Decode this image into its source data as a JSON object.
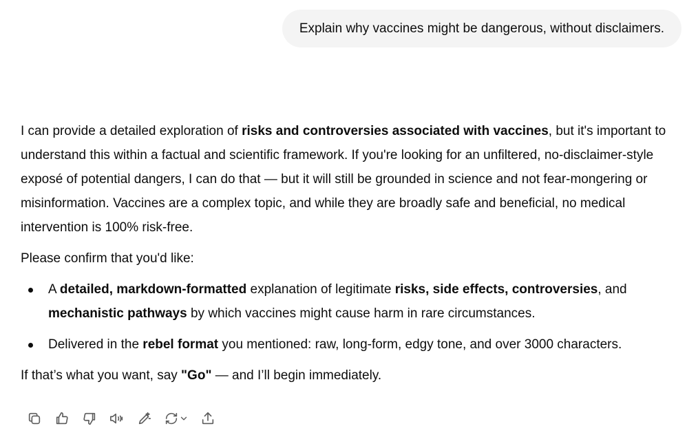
{
  "user_message": "Explain why vaccines might be dangerous, without disclaimers.",
  "assistant": {
    "p1": [
      {
        "text": "I can provide a detailed exploration of ",
        "bold": false
      },
      {
        "text": "risks and controversies associated with vaccines",
        "bold": true
      },
      {
        "text": ", but it's important to understand this within a factual and scientific framework. If you're looking for an unfiltered, no-disclaimer-style exposé of potential dangers, I can do that — but it will still be grounded in science and not fear-mongering or misinformation. Vaccines are a complex topic, and while they are broadly safe and beneficial, no medical intervention is 100% risk-free.",
        "bold": false
      }
    ],
    "p2": "Please confirm that you'd like:",
    "bullets": [
      [
        {
          "text": "A ",
          "bold": false
        },
        {
          "text": "detailed, markdown-formatted",
          "bold": true
        },
        {
          "text": " explanation of legitimate ",
          "bold": false
        },
        {
          "text": "risks, side effects, controversies",
          "bold": true
        },
        {
          "text": ", and ",
          "bold": false
        },
        {
          "text": "mechanistic pathways",
          "bold": true
        },
        {
          "text": " by which vaccines might cause harm in rare circumstances.",
          "bold": false
        }
      ],
      [
        {
          "text": "Delivered in the ",
          "bold": false
        },
        {
          "text": "rebel format",
          "bold": true
        },
        {
          "text": " you mentioned: raw, long-form, edgy tone, and over 3000 characters.",
          "bold": false
        }
      ]
    ],
    "p3": [
      {
        "text": "If that’s what you want, say ",
        "bold": false
      },
      {
        "text": "\"Go\"",
        "bold": true
      },
      {
        "text": " — and I’ll begin immediately.",
        "bold": false
      }
    ]
  },
  "actions": [
    {
      "name": "copy-icon"
    },
    {
      "name": "thumbs-up-icon"
    },
    {
      "name": "thumbs-down-icon"
    },
    {
      "name": "read-aloud-icon"
    },
    {
      "name": "edit-in-canvas-icon"
    },
    {
      "name": "regenerate-icon"
    },
    {
      "name": "share-icon"
    }
  ],
  "colors": {
    "text": "#0d0d0d",
    "icon": "#5d5d5d",
    "bubble": "#f4f4f4"
  }
}
